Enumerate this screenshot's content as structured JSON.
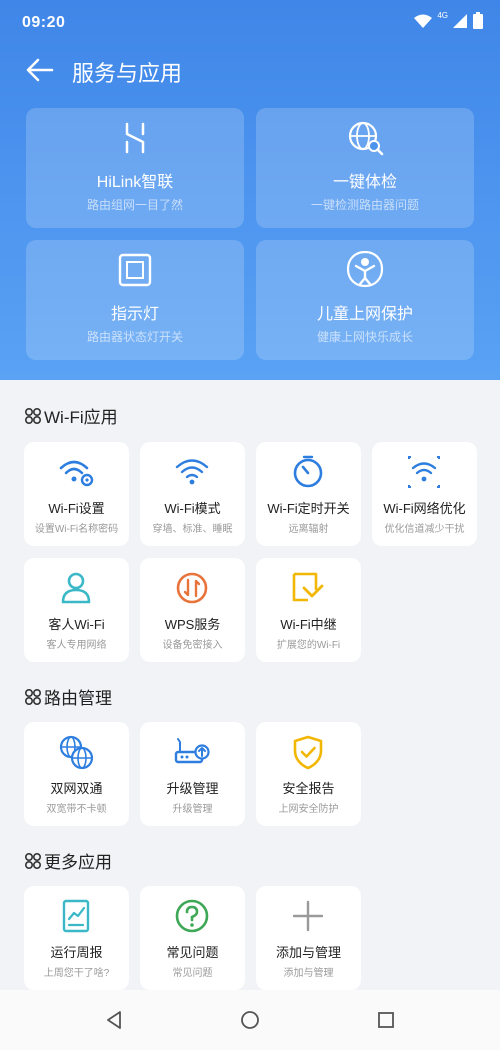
{
  "status": {
    "time": "09:20",
    "network": "4G"
  },
  "header": {
    "title": "服务与应用"
  },
  "hero_cards": [
    {
      "icon": "hilink-icon",
      "label": "HiLink智联",
      "sub": "路由组网一目了然"
    },
    {
      "icon": "globe-search-icon",
      "label": "一键体检",
      "sub": "一键检测路由器问题"
    },
    {
      "icon": "indicator-light-icon",
      "label": "指示灯",
      "sub": "路由器状态灯开关"
    },
    {
      "icon": "child-protection-icon",
      "label": "儿童上网保护",
      "sub": "健康上网快乐成长"
    }
  ],
  "sections": {
    "wifi": {
      "title": "Wi-Fi应用",
      "items": [
        {
          "icon": "wifi-settings-icon",
          "label": "Wi-Fi设置",
          "sub": "设置Wi-Fi名称密码"
        },
        {
          "icon": "wifi-mode-icon",
          "label": "Wi-Fi模式",
          "sub": "穿墙、标准、睡眠"
        },
        {
          "icon": "timer-icon",
          "label": "Wi-Fi定时开关",
          "sub": "远离辐射"
        },
        {
          "icon": "wifi-optimize-icon",
          "label": "Wi-Fi网络优化",
          "sub": "优化信道减少干扰"
        },
        {
          "icon": "guest-user-icon",
          "label": "客人Wi-Fi",
          "sub": "客人专用网络"
        },
        {
          "icon": "wps-icon",
          "label": "WPS服务",
          "sub": "设备免密接入"
        },
        {
          "icon": "wifi-repeater-icon",
          "label": "Wi-Fi中继",
          "sub": "扩展您的Wi-Fi"
        }
      ]
    },
    "router": {
      "title": "路由管理",
      "items": [
        {
          "icon": "dual-network-icon",
          "label": "双网双通",
          "sub": "双宽带不卡顿"
        },
        {
          "icon": "upgrade-router-icon",
          "label": "升级管理",
          "sub": "升级管理"
        },
        {
          "icon": "security-shield-icon",
          "label": "安全报告",
          "sub": "上网安全防护"
        }
      ]
    },
    "more": {
      "title": "更多应用",
      "items": [
        {
          "icon": "weekly-report-icon",
          "label": "运行周报",
          "sub": "上周您干了啥?"
        },
        {
          "icon": "faq-icon",
          "label": "常见问题",
          "sub": "常见问题"
        },
        {
          "icon": "add-icon",
          "label": "添加与管理",
          "sub": "添加与管理"
        }
      ]
    }
  },
  "colors": {
    "header_blue": "#4b93ee",
    "icon_blue": "#2e7ee0",
    "icon_teal": "#3ab8c8",
    "icon_orange": "#e8743b",
    "icon_yellow": "#f2b705",
    "icon_green": "#3ea856",
    "icon_gray": "#9a9a9a"
  }
}
